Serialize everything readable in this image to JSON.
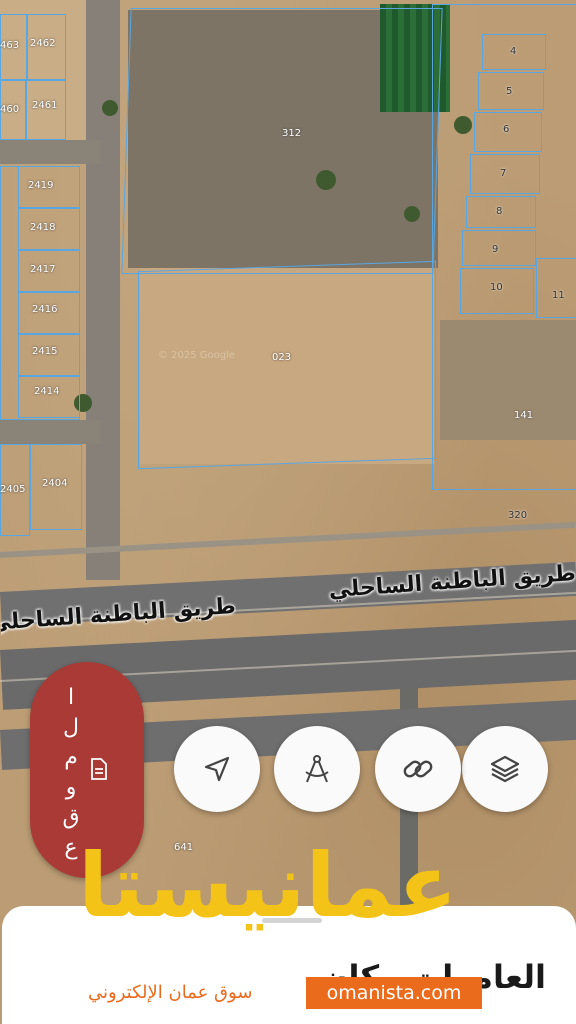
{
  "map": {
    "plots": [
      {
        "id": "p2463",
        "label": "463"
      },
      {
        "id": "p2462",
        "label": "2462"
      },
      {
        "id": "p2460",
        "label": "460"
      },
      {
        "id": "p2461",
        "label": "2461"
      },
      {
        "id": "p2419",
        "label": "2419"
      },
      {
        "id": "p2418",
        "label": "2418"
      },
      {
        "id": "p2417",
        "label": "2417"
      },
      {
        "id": "p2416",
        "label": "2416"
      },
      {
        "id": "p2415",
        "label": "2415"
      },
      {
        "id": "p2414",
        "label": "2414"
      },
      {
        "id": "p2405",
        "label": "2405"
      },
      {
        "id": "p2404",
        "label": "2404"
      },
      {
        "id": "p312",
        "label": "312"
      },
      {
        "id": "p023",
        "label": "023"
      },
      {
        "id": "p4",
        "label": "4"
      },
      {
        "id": "p5",
        "label": "5"
      },
      {
        "id": "p6",
        "label": "6"
      },
      {
        "id": "p7",
        "label": "7"
      },
      {
        "id": "p8",
        "label": "8"
      },
      {
        "id": "p9",
        "label": "9"
      },
      {
        "id": "p10",
        "label": "10"
      },
      {
        "id": "p11",
        "label": "11"
      },
      {
        "id": "p141",
        "label": "141"
      },
      {
        "id": "p320",
        "label": "320"
      },
      {
        "id": "p641",
        "label": "641"
      }
    ],
    "watermark": "© 2025 Google",
    "road_label_left": "طريق الباطنة الساحلي",
    "road_label_right": "طريق الباطنة الساحلي"
  },
  "side_tab": {
    "letters": [
      "ا",
      "ل",
      "م",
      "و",
      "ق",
      "ع"
    ],
    "icon": "document-icon"
  },
  "toolbar": {
    "buttons": [
      {
        "name": "layers-button",
        "icon": "layers-icon"
      },
      {
        "name": "share-link-button",
        "icon": "link-icon"
      },
      {
        "name": "measure-button",
        "icon": "compass-icon"
      },
      {
        "name": "my-location-button",
        "icon": "navigation-arrow-icon"
      }
    ]
  },
  "sheet": {
    "title": "العامرات مكان"
  },
  "brand": {
    "logo_text": "عمانيستا",
    "tagline": "سوق عمان الإلكتروني",
    "url": "omanista.com",
    "colors": {
      "logo": "#f4c317",
      "accent": "#ea6b1c"
    }
  },
  "colors": {
    "side_tab": "#a93a35",
    "plot_lines": "#5aa6e0"
  }
}
